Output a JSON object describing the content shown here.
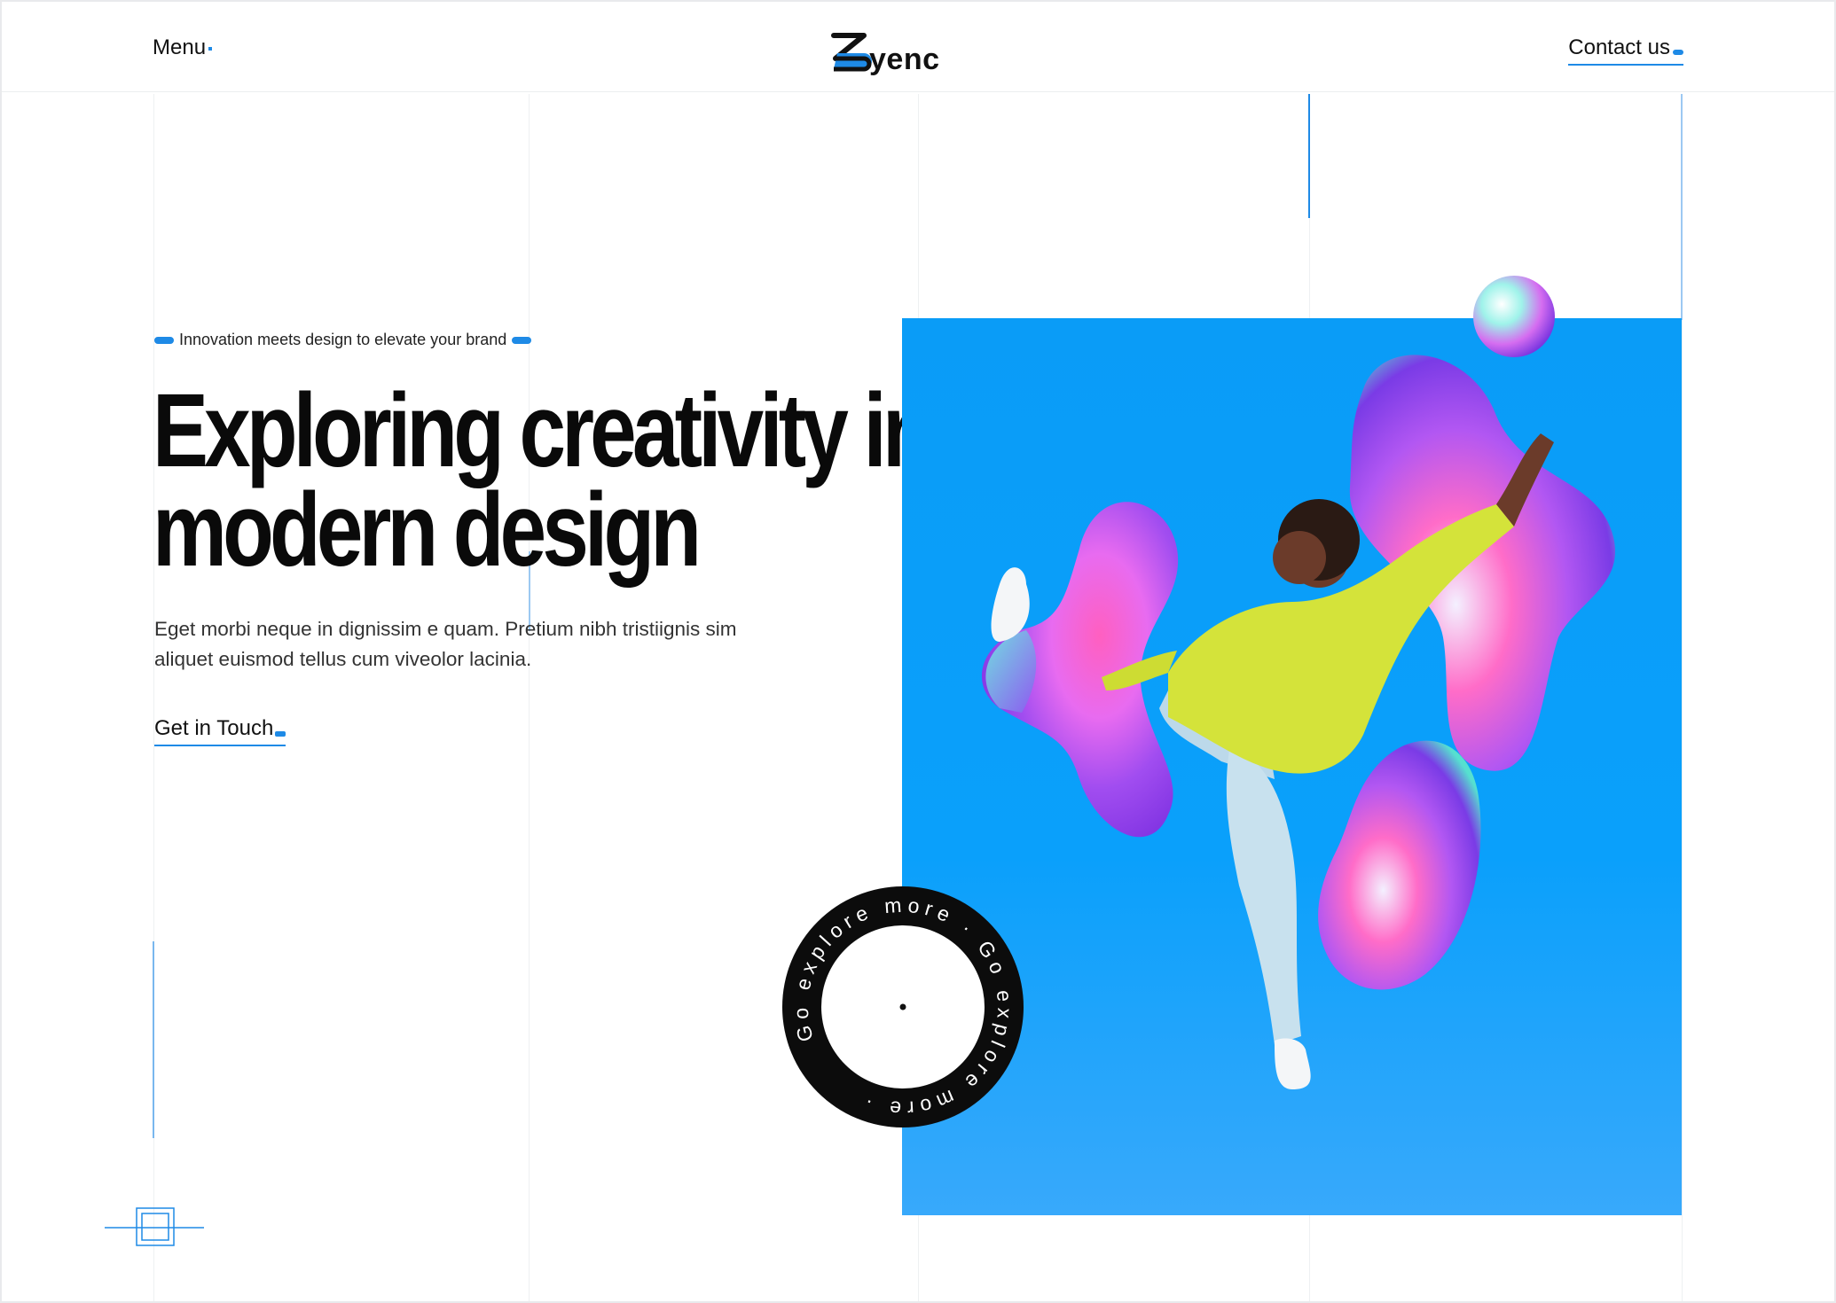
{
  "header": {
    "menu_label": "Menu",
    "logo_text": "yenc",
    "contact_label": "Contact us"
  },
  "hero": {
    "tagline": "Innovation meets design to elevate your brand",
    "title_line1": "Exploring creativity in",
    "title_line2": "modern design",
    "description_line1": "Eget morbi neque in dignissim e quam. Pretium nibh tristiignis sim",
    "description_line2": "aliquet euismod tellus cum viveolor lacinia.",
    "cta_label": "Get in Touch"
  },
  "explore_badge": {
    "ring_text": "Go explore more · Go explore more · "
  },
  "colors": {
    "accent": "#1e8ae6",
    "hero_bg": "#0a9cf7",
    "text": "#0a0a0a"
  }
}
